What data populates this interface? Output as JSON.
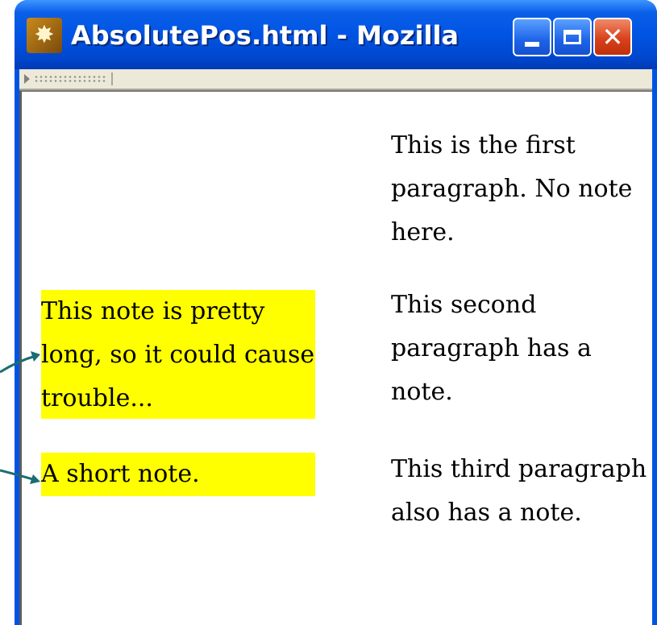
{
  "window": {
    "title": "AbsolutePos.html - Mozilla",
    "app_icon": "mozilla-icon",
    "controls": {
      "minimize": "minimize-icon",
      "maximize": "maximize-icon",
      "close": "close-icon",
      "close_glyph": "✕"
    },
    "colors": {
      "title_bar": "#0054e3",
      "close_button": "#d8421c"
    }
  },
  "content": {
    "paragraphs": [
      "This is the first paragraph. No note here.",
      "This second paragraph has a note.",
      "This third paragraph also has a note."
    ],
    "notes": [
      "This note is pretty long, so it could cause trouble...",
      "A short note."
    ],
    "note_background": "#ffff00"
  },
  "annotations": {
    "arrow_color": "#1a6e70"
  }
}
